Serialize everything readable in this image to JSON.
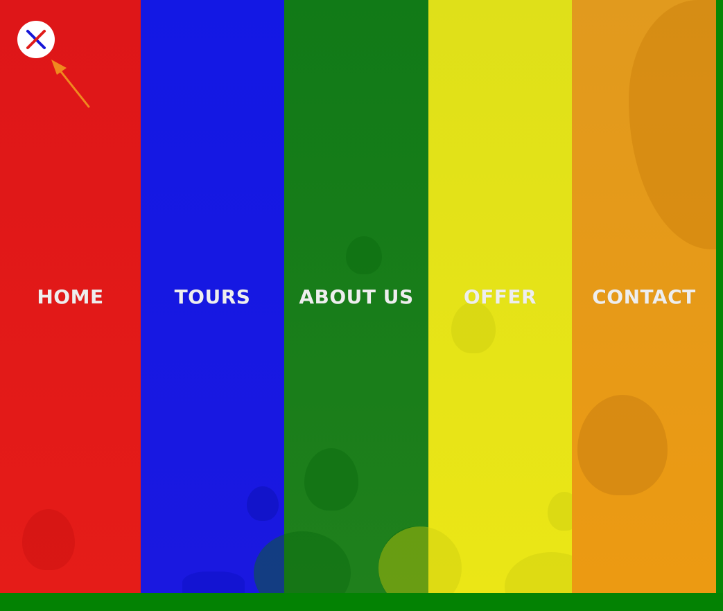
{
  "menu": {
    "items": [
      {
        "label": "HOME"
      },
      {
        "label": "TOURS"
      },
      {
        "label": "ABOUT US"
      },
      {
        "label": "OFFER"
      },
      {
        "label": "CONTACT"
      }
    ]
  },
  "colors": {
    "home": "#e01a18",
    "tours": "#1518e2",
    "about": "#18801b",
    "offer": "#e5e318",
    "contact": "#e89a18",
    "frame": "#0a7f0a",
    "close_x_red": "#e01a18",
    "close_x_blue": "#1518e2",
    "arrow": "#f0891f"
  },
  "icons": {
    "close": "close-icon",
    "annotation": "arrow-icon"
  }
}
